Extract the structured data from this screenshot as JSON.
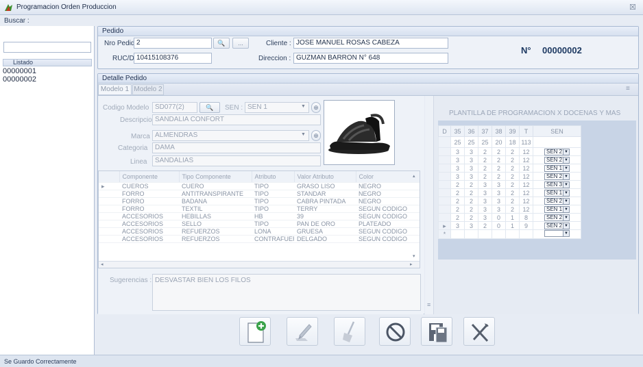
{
  "window": {
    "title": "Programacion Orden Produccion",
    "close_glyph": "☒"
  },
  "left": {
    "search_label": "Buscar :",
    "search_value": "",
    "list_header": "Listado",
    "items": [
      "00000001",
      "00000002"
    ]
  },
  "pedido": {
    "group_title": "Pedido",
    "nro_label": "Nro Pedido :",
    "nro_value": "2",
    "ruc_label": "RUC/DNI :",
    "ruc_value": "10415108376",
    "cliente_label": "Cliente :",
    "cliente_value": "JOSE MANUEL ROSAS CABEZA",
    "direccion_label": "Direccion :",
    "direccion_value": "GUZMAN BARRON N° 648",
    "num_label": "N°",
    "num_value": "00000002",
    "dots": "..."
  },
  "detalle": {
    "group_title": "Detalle Pedido",
    "tabs": [
      "Modelo 1",
      "Modelo 2"
    ]
  },
  "modelo": {
    "codigo_label": "Codigo Modelo",
    "codigo_value": "SD077(2)",
    "sen_label": "SEN :",
    "sen_value": "SEN 1",
    "descripcion_label": "Descripcion",
    "descripcion_value": "SANDALIA CONFORT",
    "marca_label": "Marca",
    "marca_value": "ALMENDRAS",
    "categoria_label": "Categoria",
    "categoria_value": "DAMA",
    "linea_label": "Linea",
    "linea_value": "SANDALIAS"
  },
  "components": {
    "headers": [
      "Componente",
      "Tipo Componente",
      "Atributo",
      "Valor Atributo",
      "Color"
    ],
    "rows": [
      [
        "CUEROS",
        "CUERO",
        "TIPO",
        "GRASO LISO",
        "NEGRO"
      ],
      [
        "FORRO",
        "ANTITRANSPIRANTE",
        "TIPO",
        "STANDAR",
        "NEGRO"
      ],
      [
        "FORRO",
        "BADANA",
        "TIPO",
        "CABRA PINTADA",
        "NEGRO"
      ],
      [
        "FORRO",
        "TEXTIL",
        "TIPO",
        "TERRY",
        "SEGUN CODIGO"
      ],
      [
        "ACCESORIOS",
        "HEBILLAS",
        "HB",
        "39",
        "SEGUN CODIGO"
      ],
      [
        "ACCESORIOS",
        "SELLO",
        "TIPO",
        "PAN DE ORO",
        "PLATEADO"
      ],
      [
        "ACCESORIOS",
        "REFUERZOS",
        "LONA",
        "GRUESA",
        "SEGUN CODIGO"
      ],
      [
        "ACCESORIOS",
        "REFUERZOS",
        "CONTRAFUERTE",
        "DELGADO",
        "SEGUN CODIGO"
      ]
    ]
  },
  "sugerencias": {
    "label": "Sugerencias :",
    "value": "DESVASTAR BIEN LOS FILOS"
  },
  "plantilla": {
    "title": "PLANTILLA DE PROGRAMACION X DOCENAS Y MAS",
    "headers": [
      "D",
      "35",
      "36",
      "37",
      "38",
      "39",
      "T",
      "SEN"
    ],
    "totals": [
      "25",
      "25",
      "25",
      "20",
      "18",
      "113"
    ],
    "rows": [
      [
        "3",
        "3",
        "2",
        "2",
        "2",
        "12",
        "SEN 2"
      ],
      [
        "3",
        "3",
        "2",
        "2",
        "2",
        "12",
        "SEN 2"
      ],
      [
        "3",
        "3",
        "2",
        "2",
        "2",
        "12",
        "SEN 1"
      ],
      [
        "3",
        "3",
        "2",
        "2",
        "2",
        "12",
        "SEN 2"
      ],
      [
        "2",
        "2",
        "3",
        "3",
        "2",
        "12",
        "SEN 3"
      ],
      [
        "2",
        "2",
        "3",
        "3",
        "2",
        "12",
        "SEN 1"
      ],
      [
        "2",
        "2",
        "3",
        "3",
        "2",
        "12",
        "SEN 2"
      ],
      [
        "2",
        "2",
        "3",
        "3",
        "2",
        "12",
        "SEN 1"
      ],
      [
        "2",
        "2",
        "3",
        "0",
        "1",
        "8",
        "SEN 2"
      ],
      [
        "3",
        "3",
        "2",
        "0",
        "1",
        "9",
        "SEN 2"
      ]
    ]
  },
  "status": {
    "text": "Se Guardo Correctamente"
  }
}
